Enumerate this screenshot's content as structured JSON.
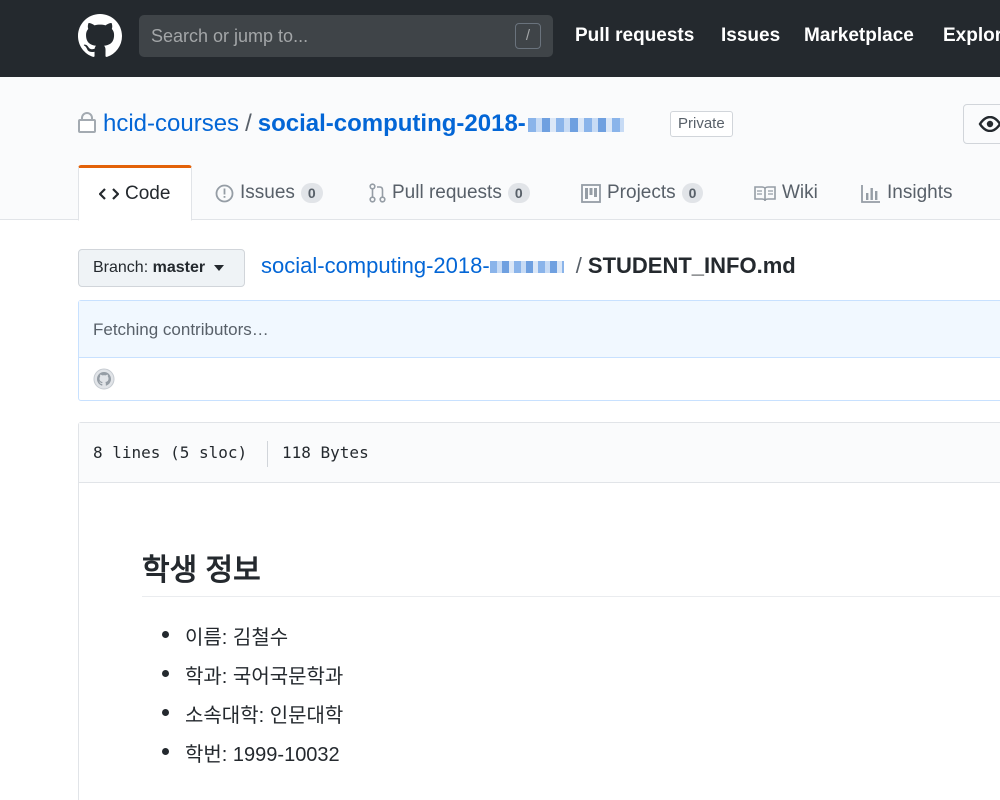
{
  "header": {
    "search_placeholder": "Search or jump to...",
    "slash_key": "/",
    "nav": [
      "Pull requests",
      "Issues",
      "Marketplace",
      "Explore"
    ]
  },
  "repo": {
    "owner": "hcid-courses",
    "separator": "/",
    "name": "social-computing-2018-",
    "visibility": "Private"
  },
  "tabs": [
    {
      "label": "Code",
      "icon": "code-icon",
      "selected": true
    },
    {
      "label": "Issues",
      "icon": "issue-icon",
      "count": "0"
    },
    {
      "label": "Pull requests",
      "icon": "pull-request-icon",
      "count": "0"
    },
    {
      "label": "Projects",
      "icon": "project-icon",
      "count": "0"
    },
    {
      "label": "Wiki",
      "icon": "book-icon"
    },
    {
      "label": "Insights",
      "icon": "graph-icon"
    }
  ],
  "branch": {
    "prefix": "Branch:",
    "name": "master"
  },
  "breadcrumb": {
    "repo": "social-computing-2018-",
    "separator": "/",
    "file": "STUDENT_INFO.md"
  },
  "contributors": {
    "status": "Fetching contributors…"
  },
  "file": {
    "lines": "8 lines (5 sloc)",
    "size": "118 Bytes"
  },
  "markdown": {
    "heading": "학생 정보",
    "items": [
      "이름: 김철수",
      "학과: 국어국문학과",
      "소속대학: 인문대학",
      "학번: 1999-10032"
    ]
  },
  "colors": {
    "header_bg": "#24292e",
    "link": "#0366d6",
    "selected_tab_accent": "#e36209"
  }
}
